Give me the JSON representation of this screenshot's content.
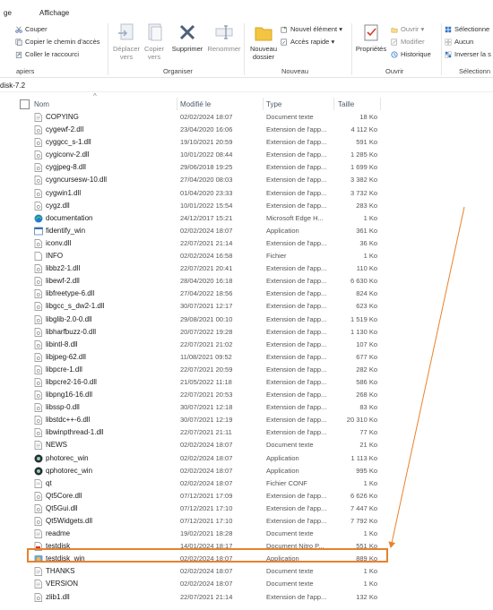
{
  "tabs": [
    "ge",
    "Affichage"
  ],
  "ribbon": {
    "clipboard": {
      "cut": "Couper",
      "copy_path": "Copier le chemin d'accès",
      "paste_shortcut": "Coller le raccourci",
      "group": "apiers"
    },
    "organize": {
      "move_to": "Déplacer vers",
      "copy_to": "Copier vers",
      "delete": "Supprimer",
      "rename": "Renommer",
      "group": "Organiser"
    },
    "new": {
      "new_folder": "Nouveau dossier",
      "new_item": "Nouvel élément",
      "easy_access": "Accès rapide",
      "group": "Nouveau"
    },
    "open": {
      "properties": "Propriétés",
      "open": "Ouvrir",
      "edit": "Modifier",
      "history": "Historique",
      "group": "Ouvrir"
    },
    "select": {
      "select_all": "Sélectionne",
      "select_none": "Aucun",
      "invert": "Inverser la s",
      "group": "Sélectionn"
    }
  },
  "address": "disk-7.2",
  "columns": {
    "name": "Nom",
    "modified": "Modifié le",
    "type": "Type",
    "size": "Taille"
  },
  "files": [
    {
      "name": "COPYING",
      "date": "02/02/2024 18:07",
      "type": "Document texte",
      "size": "18 Ko",
      "icon": "text-file"
    },
    {
      "name": "cygewf-2.dll",
      "date": "23/04/2020 16:06",
      "type": "Extension de l'app...",
      "size": "4 112 Ko",
      "icon": "dll-file"
    },
    {
      "name": "cyggcc_s-1.dll",
      "date": "19/10/2021 20:59",
      "type": "Extension de l'app...",
      "size": "591 Ko",
      "icon": "dll-file"
    },
    {
      "name": "cygiconv-2.dll",
      "date": "10/01/2022 08:44",
      "type": "Extension de l'app...",
      "size": "1 285 Ko",
      "icon": "dll-file"
    },
    {
      "name": "cygjpeg-8.dll",
      "date": "29/06/2018 19:25",
      "type": "Extension de l'app...",
      "size": "1 699 Ko",
      "icon": "dll-file"
    },
    {
      "name": "cygncursesw-10.dll",
      "date": "27/04/2020 08:03",
      "type": "Extension de l'app...",
      "size": "3 382 Ko",
      "icon": "dll-file"
    },
    {
      "name": "cygwin1.dll",
      "date": "01/04/2020 23:33",
      "type": "Extension de l'app...",
      "size": "3 732 Ko",
      "icon": "dll-file"
    },
    {
      "name": "cygz.dll",
      "date": "10/01/2022 15:54",
      "type": "Extension de l'app...",
      "size": "283 Ko",
      "icon": "dll-file"
    },
    {
      "name": "documentation",
      "date": "24/12/2017 15:21",
      "type": "Microsoft Edge H...",
      "size": "1 Ko",
      "icon": "edge-html"
    },
    {
      "name": "fidentify_win",
      "date": "02/02/2024 18:07",
      "type": "Application",
      "size": "361 Ko",
      "icon": "app"
    },
    {
      "name": "iconv.dll",
      "date": "22/07/2021 21:14",
      "type": "Extension de l'app...",
      "size": "36 Ko",
      "icon": "dll-file"
    },
    {
      "name": "INFO",
      "date": "02/02/2024 16:58",
      "type": "Fichier",
      "size": "1 Ko",
      "icon": "blank-file"
    },
    {
      "name": "libbz2-1.dll",
      "date": "22/07/2021 20:41",
      "type": "Extension de l'app...",
      "size": "110 Ko",
      "icon": "dll-file"
    },
    {
      "name": "libewf-2.dll",
      "date": "28/04/2020 16:18",
      "type": "Extension de l'app...",
      "size": "6 630 Ko",
      "icon": "dll-file"
    },
    {
      "name": "libfreetype-6.dll",
      "date": "27/04/2022 18:56",
      "type": "Extension de l'app...",
      "size": "824 Ko",
      "icon": "dll-file"
    },
    {
      "name": "libgcc_s_dw2-1.dll",
      "date": "30/07/2021 12:17",
      "type": "Extension de l'app...",
      "size": "623 Ko",
      "icon": "dll-file"
    },
    {
      "name": "libglib-2.0-0.dll",
      "date": "29/08/2021 00:10",
      "type": "Extension de l'app...",
      "size": "1 519 Ko",
      "icon": "dll-file"
    },
    {
      "name": "libharfbuzz-0.dll",
      "date": "20/07/2022 19:28",
      "type": "Extension de l'app...",
      "size": "1 130 Ko",
      "icon": "dll-file"
    },
    {
      "name": "libintl-8.dll",
      "date": "22/07/2021 21:02",
      "type": "Extension de l'app...",
      "size": "107 Ko",
      "icon": "dll-file"
    },
    {
      "name": "libjpeg-62.dll",
      "date": "11/08/2021 09:52",
      "type": "Extension de l'app...",
      "size": "677 Ko",
      "icon": "dll-file"
    },
    {
      "name": "libpcre-1.dll",
      "date": "22/07/2021 20:59",
      "type": "Extension de l'app...",
      "size": "282 Ko",
      "icon": "dll-file"
    },
    {
      "name": "libpcre2-16-0.dll",
      "date": "21/05/2022 11:18",
      "type": "Extension de l'app...",
      "size": "586 Ko",
      "icon": "dll-file"
    },
    {
      "name": "libpng16-16.dll",
      "date": "22/07/2021 20:53",
      "type": "Extension de l'app...",
      "size": "268 Ko",
      "icon": "dll-file"
    },
    {
      "name": "libssp-0.dll",
      "date": "30/07/2021 12:18",
      "type": "Extension de l'app...",
      "size": "83 Ko",
      "icon": "dll-file"
    },
    {
      "name": "libstdc++-6.dll",
      "date": "30/07/2021 12:19",
      "type": "Extension de l'app...",
      "size": "20 310 Ko",
      "icon": "dll-file"
    },
    {
      "name": "libwinpthread-1.dll",
      "date": "22/07/2021 21:11",
      "type": "Extension de l'app...",
      "size": "77 Ko",
      "icon": "dll-file"
    },
    {
      "name": "NEWS",
      "date": "02/02/2024 18:07",
      "type": "Document texte",
      "size": "21 Ko",
      "icon": "text-file"
    },
    {
      "name": "photorec_win",
      "date": "02/02/2024 18:07",
      "type": "Application",
      "size": "1 113 Ko",
      "icon": "app-round"
    },
    {
      "name": "qphotorec_win",
      "date": "02/02/2024 18:07",
      "type": "Application",
      "size": "995 Ko",
      "icon": "app-round"
    },
    {
      "name": "qt",
      "date": "02/02/2024 18:07",
      "type": "Fichier CONF",
      "size": "1 Ko",
      "icon": "conf-file"
    },
    {
      "name": "Qt5Core.dll",
      "date": "07/12/2021 17:09",
      "type": "Extension de l'app...",
      "size": "6 626 Ko",
      "icon": "dll-file"
    },
    {
      "name": "Qt5Gui.dll",
      "date": "07/12/2021 17:10",
      "type": "Extension de l'app...",
      "size": "7 447 Ko",
      "icon": "dll-file"
    },
    {
      "name": "Qt5Widgets.dll",
      "date": "07/12/2021 17:10",
      "type": "Extension de l'app...",
      "size": "7 792 Ko",
      "icon": "dll-file"
    },
    {
      "name": "readme",
      "date": "19/02/2021 18:28",
      "type": "Document texte",
      "size": "1 Ko",
      "icon": "text-file"
    },
    {
      "name": "testdisk",
      "date": "14/01/2024 18:17",
      "type": "Document Nitro P...",
      "size": "551 Ko",
      "icon": "pdf-file"
    },
    {
      "name": "testdisk_win",
      "date": "02/02/2024 18:07",
      "type": "Application",
      "size": "889 Ko",
      "icon": "app-disk"
    },
    {
      "name": "THANKS",
      "date": "02/02/2024 18:07",
      "type": "Document texte",
      "size": "1 Ko",
      "icon": "text-file"
    },
    {
      "name": "VERSION",
      "date": "02/02/2024 18:07",
      "type": "Document texte",
      "size": "1 Ko",
      "icon": "text-file"
    },
    {
      "name": "zlib1.dll",
      "date": "22/07/2021 21:14",
      "type": "Extension de l'app...",
      "size": "132 Ko",
      "icon": "dll-file"
    }
  ],
  "colors": {
    "highlight": "#e8822b",
    "accent": "#1a73c9"
  }
}
